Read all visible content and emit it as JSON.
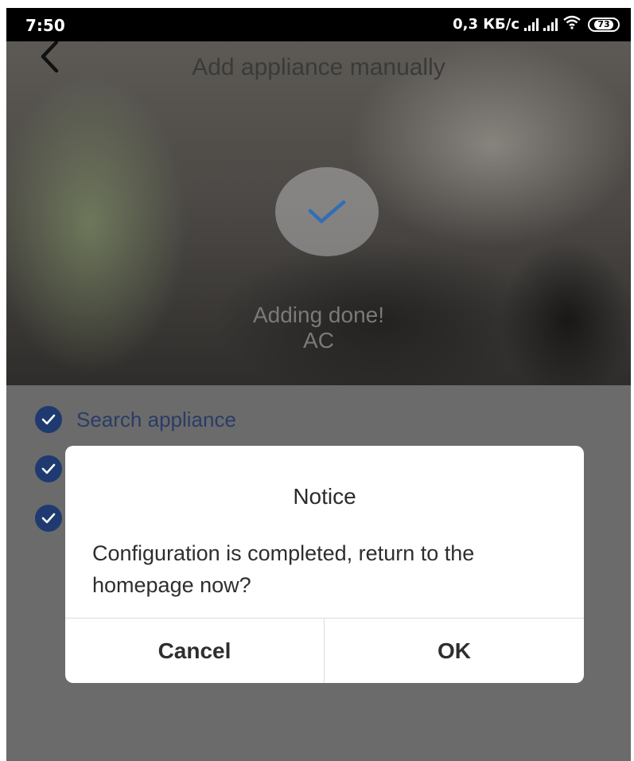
{
  "status_bar": {
    "time": "7:50",
    "network_speed": "0,3 КБ/с",
    "battery": "73",
    "icons": [
      "signal-icon",
      "signal-icon",
      "wifi-icon",
      "battery-icon"
    ]
  },
  "header": {
    "title": "Add appliance manually",
    "back_icon": "chevron-left-icon"
  },
  "result": {
    "icon": "checkmark-icon",
    "status": "Adding done!",
    "device": "AC"
  },
  "steps": [
    {
      "label": "Search appliance",
      "icon": "check-circle-icon"
    },
    {
      "label": "",
      "icon": "check-circle-icon"
    },
    {
      "label": "",
      "icon": "check-circle-icon"
    }
  ],
  "dialog": {
    "title": "Notice",
    "message": "Configuration is completed, return to the homepage now?",
    "cancel_label": "Cancel",
    "ok_label": "OK"
  },
  "colors": {
    "accent": "#1e3a70",
    "check": "#2f6fb5",
    "dim_background": "#6b6b6b"
  }
}
